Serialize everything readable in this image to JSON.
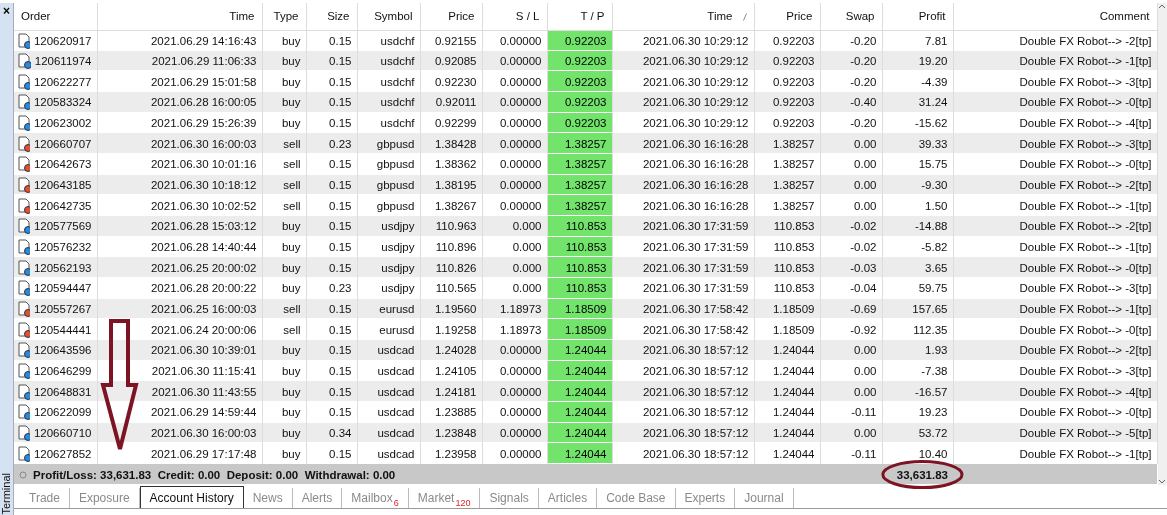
{
  "panel": {
    "title": "Terminal",
    "close": "×"
  },
  "table": {
    "columns": [
      {
        "label": "Order",
        "sorted": false
      },
      {
        "label": "Time",
        "sorted": false
      },
      {
        "label": "Type",
        "sorted": false
      },
      {
        "label": "Size",
        "sorted": false
      },
      {
        "label": "Symbol",
        "sorted": false
      },
      {
        "label": "Price",
        "sorted": false
      },
      {
        "label": "S / L",
        "sorted": false
      },
      {
        "label": "T / P",
        "sorted": false
      },
      {
        "label": "Time",
        "sorted": true
      },
      {
        "label": "Price",
        "sorted": false
      },
      {
        "label": "Swap",
        "sorted": false
      },
      {
        "label": "Profit",
        "sorted": false
      },
      {
        "label": "Comment",
        "sorted": false
      }
    ],
    "rows": [
      {
        "kind": "buy",
        "cells": [
          "120620917",
          "2021.06.29 14:16:43",
          "buy",
          "0.15",
          "usdchf",
          "0.92155",
          "0.00000",
          "0.92203",
          "2021.06.30 10:29:12",
          "0.92203",
          "-0.20",
          "7.81",
          "Double FX Robot--> -2[tp]"
        ]
      },
      {
        "kind": "buy",
        "cells": [
          "120611974",
          "2021.06.29 11:06:33",
          "buy",
          "0.15",
          "usdchf",
          "0.92085",
          "0.00000",
          "0.92203",
          "2021.06.30 10:29:12",
          "0.92203",
          "-0.20",
          "19.20",
          "Double FX Robot--> -1[tp]"
        ]
      },
      {
        "kind": "buy",
        "cells": [
          "120622277",
          "2021.06.29 15:01:58",
          "buy",
          "0.15",
          "usdchf",
          "0.92230",
          "0.00000",
          "0.92203",
          "2021.06.30 10:29:12",
          "0.92203",
          "-0.20",
          "-4.39",
          "Double FX Robot--> -3[tp]"
        ]
      },
      {
        "kind": "buy",
        "cells": [
          "120583324",
          "2021.06.28 16:00:05",
          "buy",
          "0.15",
          "usdchf",
          "0.92011",
          "0.00000",
          "0.92203",
          "2021.06.30 10:29:12",
          "0.92203",
          "-0.40",
          "31.24",
          "Double FX Robot--> -0[tp]"
        ]
      },
      {
        "kind": "buy",
        "cells": [
          "120623002",
          "2021.06.29 15:26:39",
          "buy",
          "0.15",
          "usdchf",
          "0.92299",
          "0.00000",
          "0.92203",
          "2021.06.30 10:29:12",
          "0.92203",
          "-0.20",
          "-15.62",
          "Double FX Robot--> -4[tp]"
        ]
      },
      {
        "kind": "sell",
        "cells": [
          "120660707",
          "2021.06.30 16:00:03",
          "sell",
          "0.23",
          "gbpusd",
          "1.38428",
          "0.00000",
          "1.38257",
          "2021.06.30 16:16:28",
          "1.38257",
          "0.00",
          "39.33",
          "Double FX Robot--> -3[tp]"
        ]
      },
      {
        "kind": "sell",
        "cells": [
          "120642673",
          "2021.06.30 10:01:16",
          "sell",
          "0.15",
          "gbpusd",
          "1.38362",
          "0.00000",
          "1.38257",
          "2021.06.30 16:16:28",
          "1.38257",
          "0.00",
          "15.75",
          "Double FX Robot--> -0[tp]"
        ]
      },
      {
        "kind": "sell",
        "cells": [
          "120643185",
          "2021.06.30 10:18:12",
          "sell",
          "0.15",
          "gbpusd",
          "1.38195",
          "0.00000",
          "1.38257",
          "2021.06.30 16:16:28",
          "1.38257",
          "0.00",
          "-9.30",
          "Double FX Robot--> -2[tp]"
        ]
      },
      {
        "kind": "sell",
        "cells": [
          "120642735",
          "2021.06.30 10:02:52",
          "sell",
          "0.15",
          "gbpusd",
          "1.38267",
          "0.00000",
          "1.38257",
          "2021.06.30 16:16:28",
          "1.38257",
          "0.00",
          "1.50",
          "Double FX Robot--> -1[tp]"
        ]
      },
      {
        "kind": "buy",
        "cells": [
          "120577569",
          "2021.06.28 15:03:12",
          "buy",
          "0.15",
          "usdjpy",
          "110.963",
          "0.000",
          "110.853",
          "2021.06.30 17:31:59",
          "110.853",
          "-0.02",
          "-14.88",
          "Double FX Robot--> -2[tp]"
        ]
      },
      {
        "kind": "buy",
        "cells": [
          "120576232",
          "2021.06.28 14:40:44",
          "buy",
          "0.15",
          "usdjpy",
          "110.896",
          "0.000",
          "110.853",
          "2021.06.30 17:31:59",
          "110.853",
          "-0.02",
          "-5.82",
          "Double FX Robot--> -1[tp]"
        ]
      },
      {
        "kind": "buy",
        "cells": [
          "120562193",
          "2021.06.25 20:00:02",
          "buy",
          "0.15",
          "usdjpy",
          "110.826",
          "0.000",
          "110.853",
          "2021.06.30 17:31:59",
          "110.853",
          "-0.03",
          "3.65",
          "Double FX Robot--> -0[tp]"
        ]
      },
      {
        "kind": "buy",
        "cells": [
          "120594447",
          "2021.06.28 20:00:22",
          "buy",
          "0.23",
          "usdjpy",
          "110.565",
          "0.000",
          "110.853",
          "2021.06.30 17:31:59",
          "110.853",
          "-0.04",
          "59.75",
          "Double FX Robot--> -3[tp]"
        ]
      },
      {
        "kind": "sell",
        "cells": [
          "120557267",
          "2021.06.25 16:00:03",
          "sell",
          "0.15",
          "eurusd",
          "1.19560",
          "1.18973",
          "1.18509",
          "2021.06.30 17:58:42",
          "1.18509",
          "-0.69",
          "157.65",
          "Double FX Robot--> -1[tp]"
        ]
      },
      {
        "kind": "sell",
        "cells": [
          "120544441",
          "2021.06.24 20:00:06",
          "sell",
          "0.15",
          "eurusd",
          "1.19258",
          "1.18973",
          "1.18509",
          "2021.06.30 17:58:42",
          "1.18509",
          "-0.92",
          "112.35",
          "Double FX Robot--> -0[tp]"
        ]
      },
      {
        "kind": "buy",
        "cells": [
          "120643596",
          "2021.06.30 10:39:01",
          "buy",
          "0.15",
          "usdcad",
          "1.24028",
          "0.00000",
          "1.24044",
          "2021.06.30 18:57:12",
          "1.24044",
          "0.00",
          "1.93",
          "Double FX Robot--> -2[tp]"
        ]
      },
      {
        "kind": "buy",
        "cells": [
          "120646299",
          "2021.06.30 11:15:41",
          "buy",
          "0.15",
          "usdcad",
          "1.24105",
          "0.00000",
          "1.24044",
          "2021.06.30 18:57:12",
          "1.24044",
          "0.00",
          "-7.38",
          "Double FX Robot--> -3[tp]"
        ]
      },
      {
        "kind": "buy",
        "cells": [
          "120648831",
          "2021.06.30 11:43:55",
          "buy",
          "0.15",
          "usdcad",
          "1.24181",
          "0.00000",
          "1.24044",
          "2021.06.30 18:57:12",
          "1.24044",
          "0.00",
          "-16.57",
          "Double FX Robot--> -4[tp]"
        ]
      },
      {
        "kind": "buy",
        "cells": [
          "120622099",
          "2021.06.29 14:59:44",
          "buy",
          "0.15",
          "usdcad",
          "1.23885",
          "0.00000",
          "1.24044",
          "2021.06.30 18:57:12",
          "1.24044",
          "-0.11",
          "19.23",
          "Double FX Robot--> -0[tp]"
        ]
      },
      {
        "kind": "buy",
        "cells": [
          "120660710",
          "2021.06.30 16:00:03",
          "buy",
          "0.34",
          "usdcad",
          "1.23848",
          "0.00000",
          "1.24044",
          "2021.06.30 18:57:12",
          "1.24044",
          "0.00",
          "53.72",
          "Double FX Robot--> -5[tp]"
        ]
      },
      {
        "kind": "buy",
        "cells": [
          "120627852",
          "2021.06.29 17:17:48",
          "buy",
          "0.15",
          "usdcad",
          "1.23958",
          "0.00000",
          "1.24044",
          "2021.06.30 18:57:12",
          "1.24044",
          "-0.11",
          "10.40",
          "Double FX Robot--> -1[tp]"
        ]
      }
    ],
    "summary": {
      "text": "Profit/Loss: 33,631.83  Credit: 0.00  Deposit: 0.00  Withdrawal: 0.00",
      "profit": "33,631.83"
    }
  },
  "tabs": [
    {
      "label": "Trade",
      "selected": false
    },
    {
      "label": "Exposure",
      "selected": false
    },
    {
      "label": "Account History",
      "selected": true
    },
    {
      "label": "News",
      "selected": false
    },
    {
      "label": "Alerts",
      "selected": false
    },
    {
      "label": "Mailbox",
      "badge": "6",
      "selected": false
    },
    {
      "label": "Market",
      "badge": "120",
      "selected": false
    },
    {
      "label": "Signals",
      "selected": false
    },
    {
      "label": "Articles",
      "selected": false
    },
    {
      "label": "Code Base",
      "selected": false
    },
    {
      "label": "Experts",
      "selected": false
    },
    {
      "label": "Journal",
      "selected": false
    }
  ]
}
